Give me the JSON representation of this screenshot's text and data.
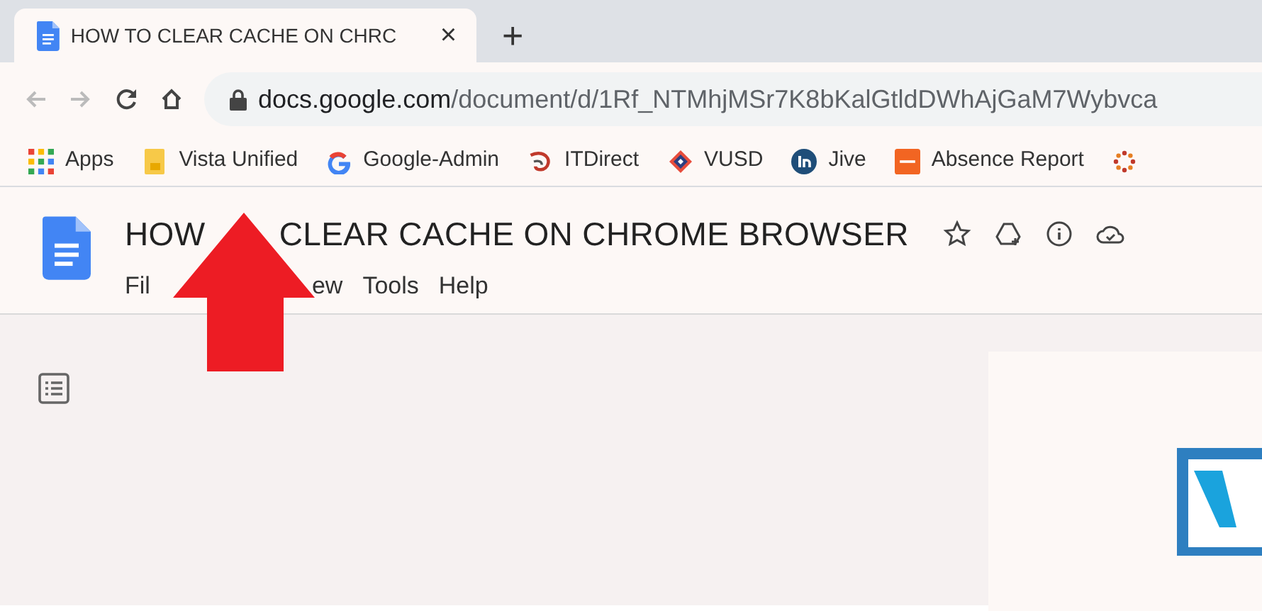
{
  "tab": {
    "title": "HOW TO CLEAR CACHE ON CHRC",
    "close": "×",
    "new_tab": "+"
  },
  "address": {
    "host": "docs.google.com",
    "path": "/document/d/1Rf_NTMhjMSr7K8bKalGtldDWhAjGaM7Wybvca"
  },
  "bookmarks": [
    {
      "label": "Apps",
      "kind": "apps"
    },
    {
      "label": "Vista Unified",
      "kind": "folder"
    },
    {
      "label": "Google-Admin",
      "kind": "google"
    },
    {
      "label": "ITDirect",
      "kind": "swirl"
    },
    {
      "label": "VUSD",
      "kind": "diamond"
    },
    {
      "label": "Jive",
      "kind": "circle"
    },
    {
      "label": "Absence Report",
      "kind": "sfe"
    },
    {
      "kind": "dots"
    }
  ],
  "document": {
    "title_parts": [
      "HOW",
      "CLEAR CACHE ON CHROME BROWSER"
    ],
    "menus": [
      "Fil",
      "ew",
      "Tools",
      "Help"
    ]
  },
  "annotation": {
    "kind": "arrow"
  }
}
